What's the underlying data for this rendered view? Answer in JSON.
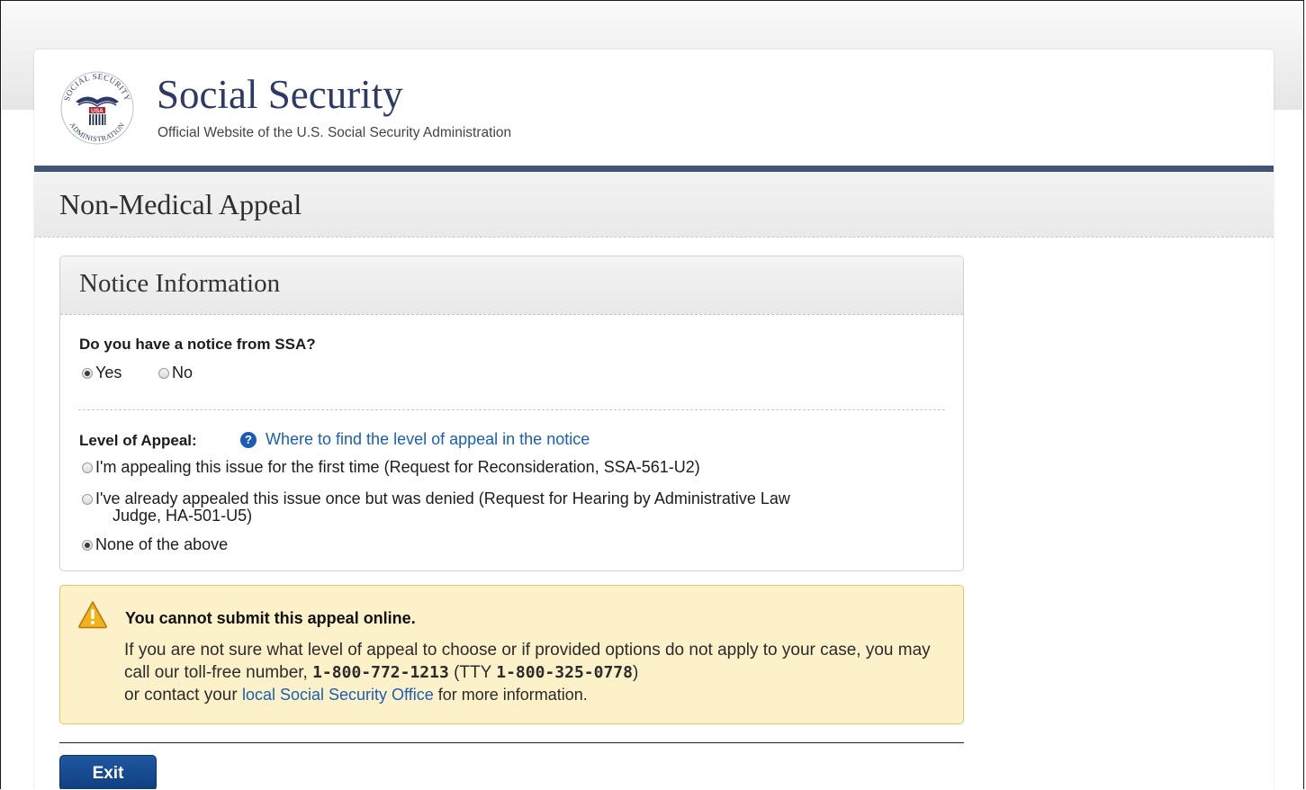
{
  "header": {
    "seal_icon": "ssa-seal-icon",
    "seal_text": "SOCIAL SECURITY ADMINISTRATION USA",
    "title": "Social Security",
    "subtitle": "Official Website of the U.S. Social Security Administration"
  },
  "page": {
    "title": "Non-Medical Appeal"
  },
  "notice_panel": {
    "title": "Notice Information",
    "question": "Do you have a notice from SSA?",
    "options": [
      {
        "label": "Yes",
        "checked": true
      },
      {
        "label": "No",
        "checked": false
      }
    ],
    "level_label": "Level of Appeal:",
    "help_icon": "question-circle-icon",
    "help_link": "Where to find the level of appeal in the notice",
    "level_options": [
      {
        "label": "I'm appealing this issue for the first time (Request for Reconsideration, SSA-561-U2)",
        "checked": false
      },
      {
        "label_line1": "I've already appealed this issue once but was denied (Request for Hearing by Administrative Law",
        "label_line2": "Judge,  HA-501-U5)",
        "checked": false
      },
      {
        "label": "None of the above",
        "checked": true
      }
    ]
  },
  "alert": {
    "icon": "warning-triangle-icon",
    "title": "You cannot submit this appeal online.",
    "body_part1": "If you are not sure what level of appeal to choose or if provided options do not apply to your case, you may call our toll-free number, ",
    "phone": "1-800-772-1213",
    "tty_open": " (TTY ",
    "tty_phone": "1-800-325-0778",
    "tty_close": ")",
    "body_part2": " or contact your ",
    "link": "local Social Security Office",
    "body_part3": " for more information.",
    "colors": {
      "background": "#fcf1c9",
      "border": "#e8c565"
    }
  },
  "actions": {
    "exit_label": "Exit"
  },
  "colors": {
    "brand_blue": "#2d3a66",
    "header_rule": "#435577",
    "link": "#1a5fb4",
    "button": "#1f57a0"
  }
}
